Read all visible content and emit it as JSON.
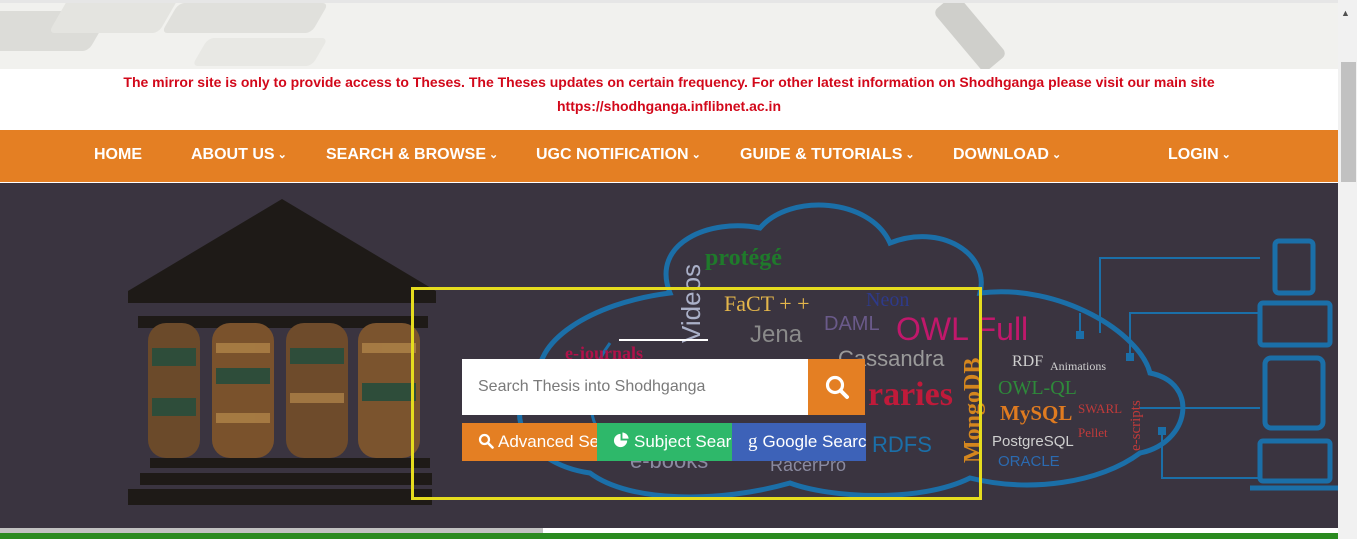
{
  "notice": {
    "line1": "The mirror site is only to provide access to Theses. The Theses updates on certain frequency. For other latest information on Shodhganga please visit our main site",
    "link": "https://shodhganga.inflibnet.ac.in"
  },
  "nav": {
    "home": "HOME",
    "about": "ABOUT US",
    "search_browse": "SEARCH & BROWSE",
    "ugc": "UGC NOTIFICATION",
    "guide": "GUIDE & TUTORIALS",
    "download": "DOWNLOAD",
    "login": "LOGIN"
  },
  "search": {
    "placeholder": "Search Thesis into Shodhganga",
    "advanced_label": "Advanced Search",
    "subject_label": "Subject Search",
    "google_label": "Google Search"
  },
  "cloud_words": {
    "protege": "protégé",
    "fact": "FaCT + +",
    "neon": "Neon",
    "daml": "DAML",
    "owl_full": "OWL Full",
    "jena": "Jena",
    "videos": "Videos",
    "cassandra": "Cassandra",
    "ejournals": "e-journals",
    "rdf": "RDF",
    "animations": "Animations",
    "owl_ql": "OWL-QL",
    "mysql": "MySQL",
    "libraries": "raries",
    "mongodb": "MongoDB",
    "swarl": "SWARL",
    "pellet": "Pellet",
    "escripts": "e-scripts",
    "postgresql": "PostgreSQL",
    "oracle": "ORACLE",
    "ebooks": "e-books",
    "racerpro": "RacerPro",
    "rdfs": "RDFS"
  },
  "colors": {
    "accent_orange": "#e47f23",
    "notice_red": "#d2081a",
    "frame_yellow": "#e5dc1e",
    "subject_green": "#2eb86a",
    "google_blue": "#3d62b8",
    "hero_bg": "#3a3440"
  },
  "icons": {
    "search_button": "search-icon",
    "advanced": "search-icon",
    "subject": "pie-chart-icon",
    "google": "google-g-icon",
    "dropdown": "chevron-down-icon"
  }
}
